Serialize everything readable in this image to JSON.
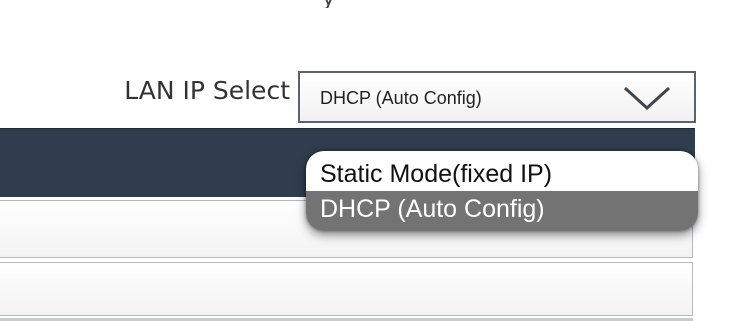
{
  "lan_ip_select": {
    "label": "LAN IP Select",
    "selected_value": "DHCP (Auto Config)",
    "arrow_icon": "chevron-down-icon",
    "options": [
      {
        "label": "Static Mode(fixed IP)",
        "highlighted": false
      },
      {
        "label": "DHCP (Auto Config)",
        "highlighted": true
      }
    ]
  },
  "colors": {
    "header_bar": "#2f3d4d",
    "highlight": "#737373",
    "select_border": "#5a6470"
  }
}
